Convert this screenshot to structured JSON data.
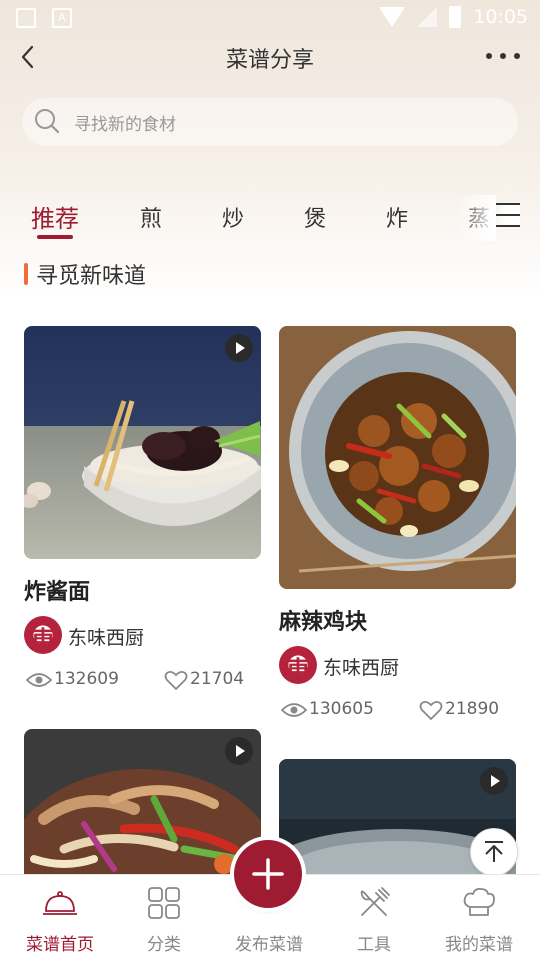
{
  "status_bar": {
    "time": "10:05",
    "app_icon_letter": "A"
  },
  "header": {
    "title": "菜谱分享"
  },
  "search": {
    "placeholder": "寻找新的食材"
  },
  "tabs": [
    {
      "label": "推荐",
      "active": true
    },
    {
      "label": "煎"
    },
    {
      "label": "炒"
    },
    {
      "label": "煲"
    },
    {
      "label": "炸"
    },
    {
      "label": "蒸"
    }
  ],
  "section": {
    "title": "寻觅新味道"
  },
  "recipes": [
    {
      "title": "炸酱面",
      "author": "东味西厨",
      "author_avatar_glyph": "東",
      "views": "132609",
      "likes": "21704",
      "has_video": true
    },
    {
      "title": "麻辣鸡块",
      "author": "东味西厨",
      "author_avatar_glyph": "東",
      "views": "130605",
      "likes": "21890",
      "has_video": true
    },
    {
      "title": "",
      "has_video": true
    },
    {
      "title": "",
      "has_video": true
    }
  ],
  "bottom_nav": [
    {
      "label": "菜谱首页",
      "icon": "cloche-icon",
      "active": true
    },
    {
      "label": "分类",
      "icon": "grid-icon"
    },
    {
      "label": "发布菜谱",
      "icon": "plus-icon"
    },
    {
      "label": "工具",
      "icon": "utensils-icon"
    },
    {
      "label": "我的菜谱",
      "icon": "chef-hat-icon"
    }
  ],
  "colors": {
    "accent": "#9e1b32",
    "section_marker": "#f26b3a"
  }
}
